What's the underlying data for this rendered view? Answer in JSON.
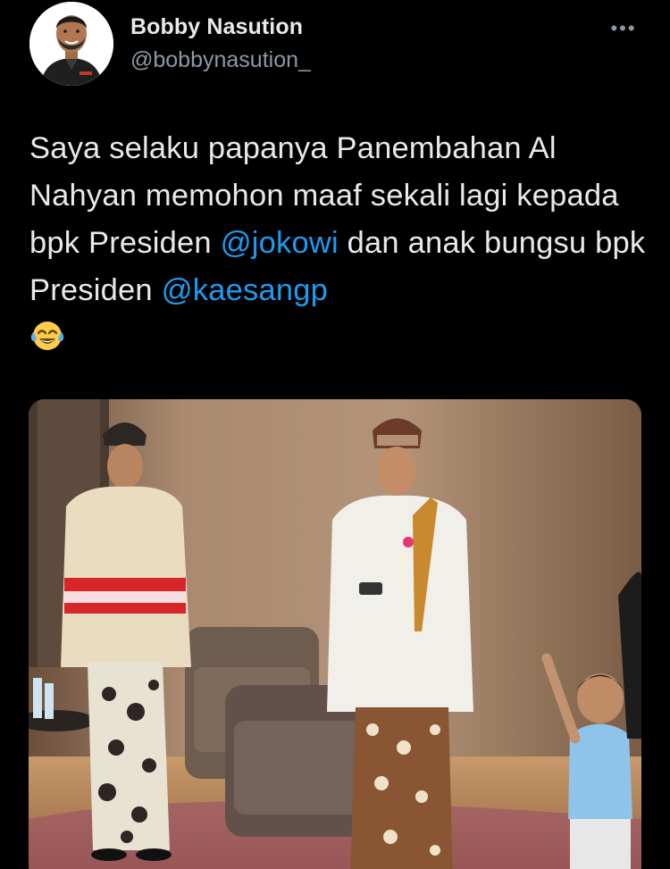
{
  "tweet": {
    "author": {
      "display_name": "Bobby Nasution",
      "handle": "@bobbynasution_",
      "avatar_icon": "profile-photo"
    },
    "more_icon": "more-horizontal-icon",
    "text": {
      "part1": "Saya selaku papanya Panembahan Al Nahyan memohon maaf sekali lagi kepada bpk Presiden ",
      "mention1": "@jokowi",
      "part2": " dan anak bungsu bpk Presiden ",
      "mention2": "@kaesangp",
      "emoji": "face-with-tears-of-joy"
    },
    "media": {
      "type": "photo",
      "description_icon": "photo"
    }
  },
  "colors": {
    "background": "#000000",
    "text_primary": "#e7e9ea",
    "text_secondary": "#8b98a5",
    "link": "#1d9bf0"
  }
}
